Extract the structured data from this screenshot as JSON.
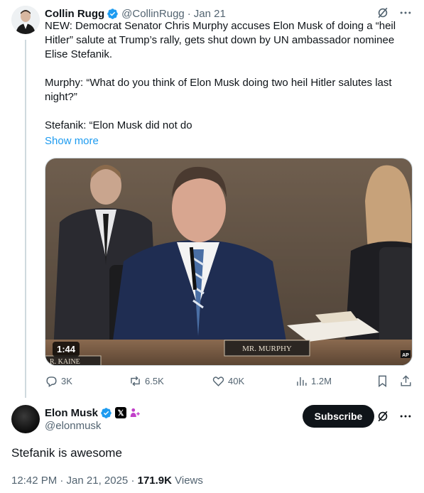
{
  "tweet": {
    "author_name": "Collin Rugg",
    "handle": "@CollinRugg",
    "separator": "·",
    "date": "Jan 21",
    "paragraphs": [
      "NEW: Democrat Senator Chris Murphy accuses Elon Musk of doing a “heil Hitler” salute at Trump’s rally, gets shut down by UN ambassador nominee Elise Stefanik.",
      "Murphy: “What do you think of Elon Musk doing two heil Hitler salutes last night?”",
      "Stefanik: “Elon Musk did not do"
    ],
    "show_more": "Show more",
    "media": {
      "duration": "1:44",
      "nameplate_main": "MR. MURPHY",
      "nameplate_side": "R. KAINE",
      "watermark": "AP"
    },
    "stats": {
      "replies": "3K",
      "retweets": "6.5K",
      "likes": "40K",
      "views": "1.2M"
    }
  },
  "reply": {
    "author_name": "Elon Musk",
    "handle": "@elonmusk",
    "affiliate_badge": "𝕏",
    "subscribe_label": "Subscribe",
    "text": "Stefanik is awesome",
    "timestamp": "12:42 PM · Jan 21, 2025 · ",
    "views_count": "171.9K",
    "views_label": " Views"
  },
  "colors": {
    "accent": "#1d9bf0",
    "text": "#0f1419",
    "muted": "#536471",
    "border": "#cfd9de"
  }
}
